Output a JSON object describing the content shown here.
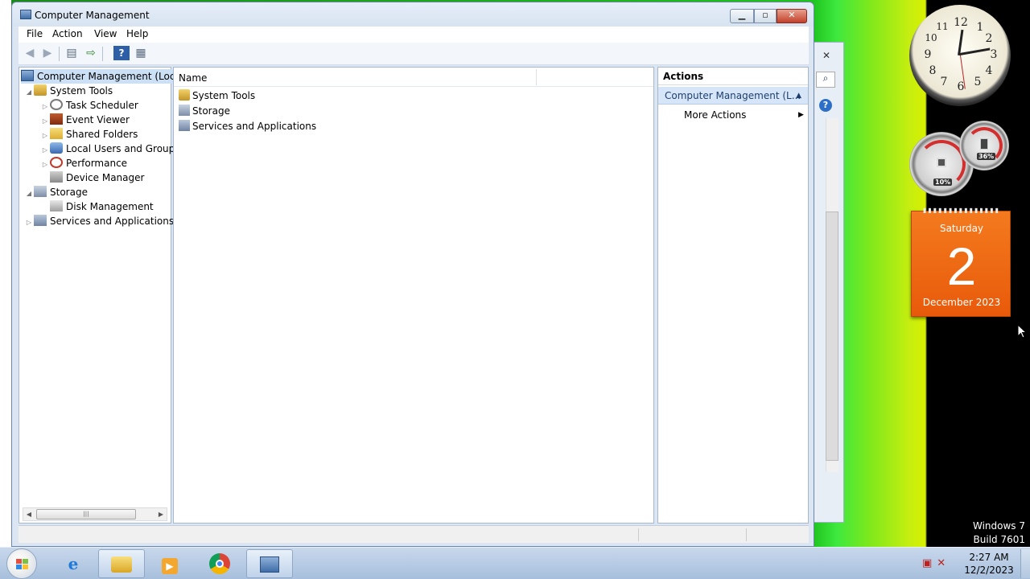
{
  "window": {
    "title": "Computer Management",
    "min_label": "▁",
    "max_label": "▫",
    "close_label": "✕"
  },
  "menu": [
    "File",
    "Action",
    "View",
    "Help"
  ],
  "toolbar": {
    "back_icon": "◀",
    "forward_icon": "▶",
    "show_hide_tree_icon": "▤",
    "export_list_icon": "⇨",
    "help_icon": "?",
    "show_hide_action_pane_icon": "▦"
  },
  "tree": {
    "root": "Computer Management (Local",
    "system_tools": "System Tools",
    "task_scheduler": "Task Scheduler",
    "event_viewer": "Event Viewer",
    "shared_folders": "Shared Folders",
    "local_users_groups": "Local Users and Groups",
    "performance": "Performance",
    "device_manager": "Device Manager",
    "storage": "Storage",
    "disk_management": "Disk Management",
    "services_apps": "Services and Applications"
  },
  "list": {
    "column_name": "Name",
    "rows": [
      "System Tools",
      "Storage",
      "Services and Applications"
    ]
  },
  "actions": {
    "title": "Actions",
    "section": "Computer Management (L...",
    "more": "More Actions"
  },
  "gadgets": {
    "clock_numbers": [
      "12",
      "1",
      "2",
      "3",
      "4",
      "5",
      "6",
      "7",
      "8",
      "9",
      "10",
      "11"
    ],
    "cpu_percent": "10%",
    "memory_percent": "36%",
    "calendar_day": "Saturday",
    "calendar_date": "2",
    "calendar_month": "December 2023"
  },
  "watermark": {
    "line1": "Windows 7",
    "line2": "Build 7601"
  },
  "taskbar": {
    "time": "2:27 AM",
    "date": "12/2/2023",
    "apps": [
      "internet-explorer-icon",
      "windows-explorer-icon",
      "media-player-icon",
      "chrome-icon",
      "computer-management-icon"
    ]
  }
}
